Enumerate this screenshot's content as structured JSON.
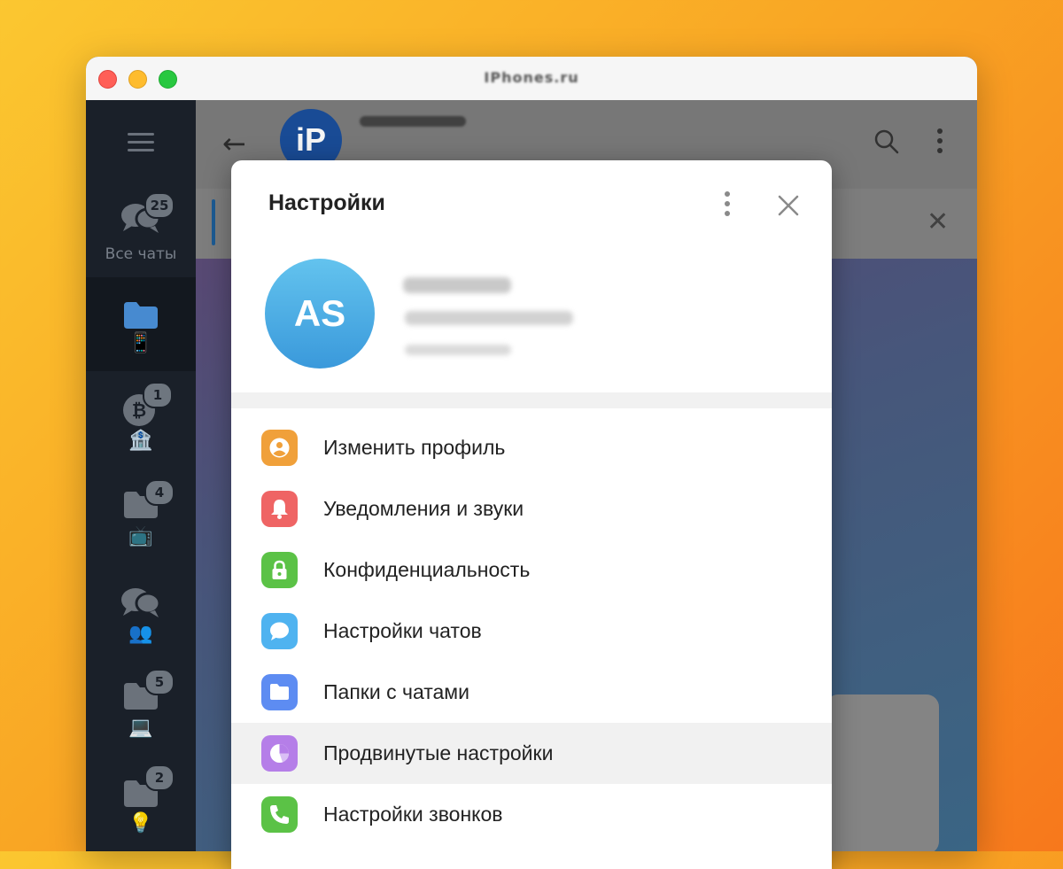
{
  "window": {
    "title": "IPhones.ru"
  },
  "sidebar": {
    "folders": [
      {
        "label": "Все чаты",
        "badge": "25",
        "emoji": ""
      },
      {
        "label": "",
        "badge": "",
        "emoji": "📱"
      },
      {
        "label": "",
        "badge": "1",
        "emoji": "🏦"
      },
      {
        "label": "",
        "badge": "4",
        "emoji": "📺"
      },
      {
        "label": "",
        "badge": "",
        "emoji": "👥"
      },
      {
        "label": "",
        "badge": "5",
        "emoji": "💻"
      },
      {
        "label": "",
        "badge": "2",
        "emoji": "💡"
      }
    ]
  },
  "chat_header": {
    "avatar_text": "iP"
  },
  "settings": {
    "title": "Настройки",
    "avatar_initials": "AS",
    "menu": [
      {
        "label": "Изменить профиль",
        "color": "#f0a03a",
        "icon": "profile-icon"
      },
      {
        "label": "Уведомления и звуки",
        "color": "#ef6464",
        "icon": "bell-icon"
      },
      {
        "label": "Конфиденциальность",
        "color": "#5bc246",
        "icon": "lock-icon"
      },
      {
        "label": "Настройки чатов",
        "color": "#4fb3f0",
        "icon": "chat-bubble-icon"
      },
      {
        "label": "Папки с чатами",
        "color": "#5d8cf2",
        "icon": "folder-icon"
      },
      {
        "label": "Продвинутые настройки",
        "color": "#b57ee8",
        "icon": "pie-chart-icon"
      },
      {
        "label": "Настройки звонков",
        "color": "#5bc246",
        "icon": "phone-icon"
      }
    ]
  }
}
